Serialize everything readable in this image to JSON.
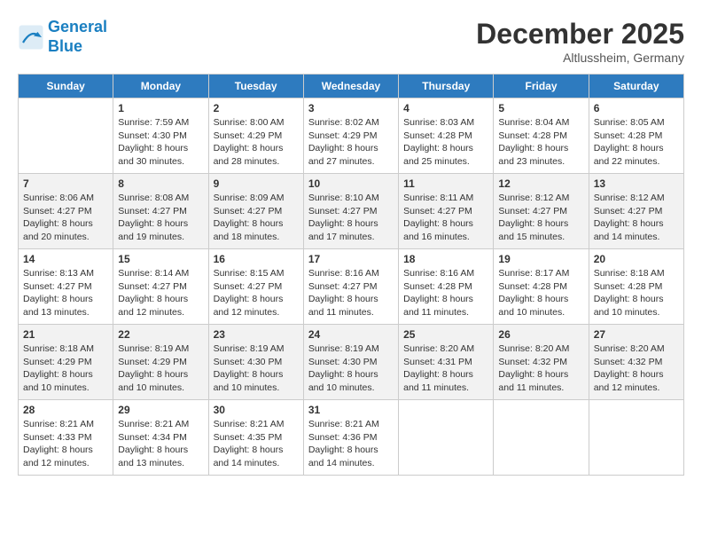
{
  "logo": {
    "line1": "General",
    "line2": "Blue"
  },
  "header": {
    "month": "December 2025",
    "location": "Altlussheim, Germany"
  },
  "days_of_week": [
    "Sunday",
    "Monday",
    "Tuesday",
    "Wednesday",
    "Thursday",
    "Friday",
    "Saturday"
  ],
  "weeks": [
    [
      {
        "day": "",
        "info": ""
      },
      {
        "day": "1",
        "info": "Sunrise: 7:59 AM\nSunset: 4:30 PM\nDaylight: 8 hours\nand 30 minutes."
      },
      {
        "day": "2",
        "info": "Sunrise: 8:00 AM\nSunset: 4:29 PM\nDaylight: 8 hours\nand 28 minutes."
      },
      {
        "day": "3",
        "info": "Sunrise: 8:02 AM\nSunset: 4:29 PM\nDaylight: 8 hours\nand 27 minutes."
      },
      {
        "day": "4",
        "info": "Sunrise: 8:03 AM\nSunset: 4:28 PM\nDaylight: 8 hours\nand 25 minutes."
      },
      {
        "day": "5",
        "info": "Sunrise: 8:04 AM\nSunset: 4:28 PM\nDaylight: 8 hours\nand 23 minutes."
      },
      {
        "day": "6",
        "info": "Sunrise: 8:05 AM\nSunset: 4:28 PM\nDaylight: 8 hours\nand 22 minutes."
      }
    ],
    [
      {
        "day": "7",
        "info": "Sunrise: 8:06 AM\nSunset: 4:27 PM\nDaylight: 8 hours\nand 20 minutes."
      },
      {
        "day": "8",
        "info": "Sunrise: 8:08 AM\nSunset: 4:27 PM\nDaylight: 8 hours\nand 19 minutes."
      },
      {
        "day": "9",
        "info": "Sunrise: 8:09 AM\nSunset: 4:27 PM\nDaylight: 8 hours\nand 18 minutes."
      },
      {
        "day": "10",
        "info": "Sunrise: 8:10 AM\nSunset: 4:27 PM\nDaylight: 8 hours\nand 17 minutes."
      },
      {
        "day": "11",
        "info": "Sunrise: 8:11 AM\nSunset: 4:27 PM\nDaylight: 8 hours\nand 16 minutes."
      },
      {
        "day": "12",
        "info": "Sunrise: 8:12 AM\nSunset: 4:27 PM\nDaylight: 8 hours\nand 15 minutes."
      },
      {
        "day": "13",
        "info": "Sunrise: 8:12 AM\nSunset: 4:27 PM\nDaylight: 8 hours\nand 14 minutes."
      }
    ],
    [
      {
        "day": "14",
        "info": "Sunrise: 8:13 AM\nSunset: 4:27 PM\nDaylight: 8 hours\nand 13 minutes."
      },
      {
        "day": "15",
        "info": "Sunrise: 8:14 AM\nSunset: 4:27 PM\nDaylight: 8 hours\nand 12 minutes."
      },
      {
        "day": "16",
        "info": "Sunrise: 8:15 AM\nSunset: 4:27 PM\nDaylight: 8 hours\nand 12 minutes."
      },
      {
        "day": "17",
        "info": "Sunrise: 8:16 AM\nSunset: 4:27 PM\nDaylight: 8 hours\nand 11 minutes."
      },
      {
        "day": "18",
        "info": "Sunrise: 8:16 AM\nSunset: 4:28 PM\nDaylight: 8 hours\nand 11 minutes."
      },
      {
        "day": "19",
        "info": "Sunrise: 8:17 AM\nSunset: 4:28 PM\nDaylight: 8 hours\nand 10 minutes."
      },
      {
        "day": "20",
        "info": "Sunrise: 8:18 AM\nSunset: 4:28 PM\nDaylight: 8 hours\nand 10 minutes."
      }
    ],
    [
      {
        "day": "21",
        "info": "Sunrise: 8:18 AM\nSunset: 4:29 PM\nDaylight: 8 hours\nand 10 minutes."
      },
      {
        "day": "22",
        "info": "Sunrise: 8:19 AM\nSunset: 4:29 PM\nDaylight: 8 hours\nand 10 minutes."
      },
      {
        "day": "23",
        "info": "Sunrise: 8:19 AM\nSunset: 4:30 PM\nDaylight: 8 hours\nand 10 minutes."
      },
      {
        "day": "24",
        "info": "Sunrise: 8:19 AM\nSunset: 4:30 PM\nDaylight: 8 hours\nand 10 minutes."
      },
      {
        "day": "25",
        "info": "Sunrise: 8:20 AM\nSunset: 4:31 PM\nDaylight: 8 hours\nand 11 minutes."
      },
      {
        "day": "26",
        "info": "Sunrise: 8:20 AM\nSunset: 4:32 PM\nDaylight: 8 hours\nand 11 minutes."
      },
      {
        "day": "27",
        "info": "Sunrise: 8:20 AM\nSunset: 4:32 PM\nDaylight: 8 hours\nand 12 minutes."
      }
    ],
    [
      {
        "day": "28",
        "info": "Sunrise: 8:21 AM\nSunset: 4:33 PM\nDaylight: 8 hours\nand 12 minutes."
      },
      {
        "day": "29",
        "info": "Sunrise: 8:21 AM\nSunset: 4:34 PM\nDaylight: 8 hours\nand 13 minutes."
      },
      {
        "day": "30",
        "info": "Sunrise: 8:21 AM\nSunset: 4:35 PM\nDaylight: 8 hours\nand 14 minutes."
      },
      {
        "day": "31",
        "info": "Sunrise: 8:21 AM\nSunset: 4:36 PM\nDaylight: 8 hours\nand 14 minutes."
      },
      {
        "day": "",
        "info": ""
      },
      {
        "day": "",
        "info": ""
      },
      {
        "day": "",
        "info": ""
      }
    ]
  ]
}
